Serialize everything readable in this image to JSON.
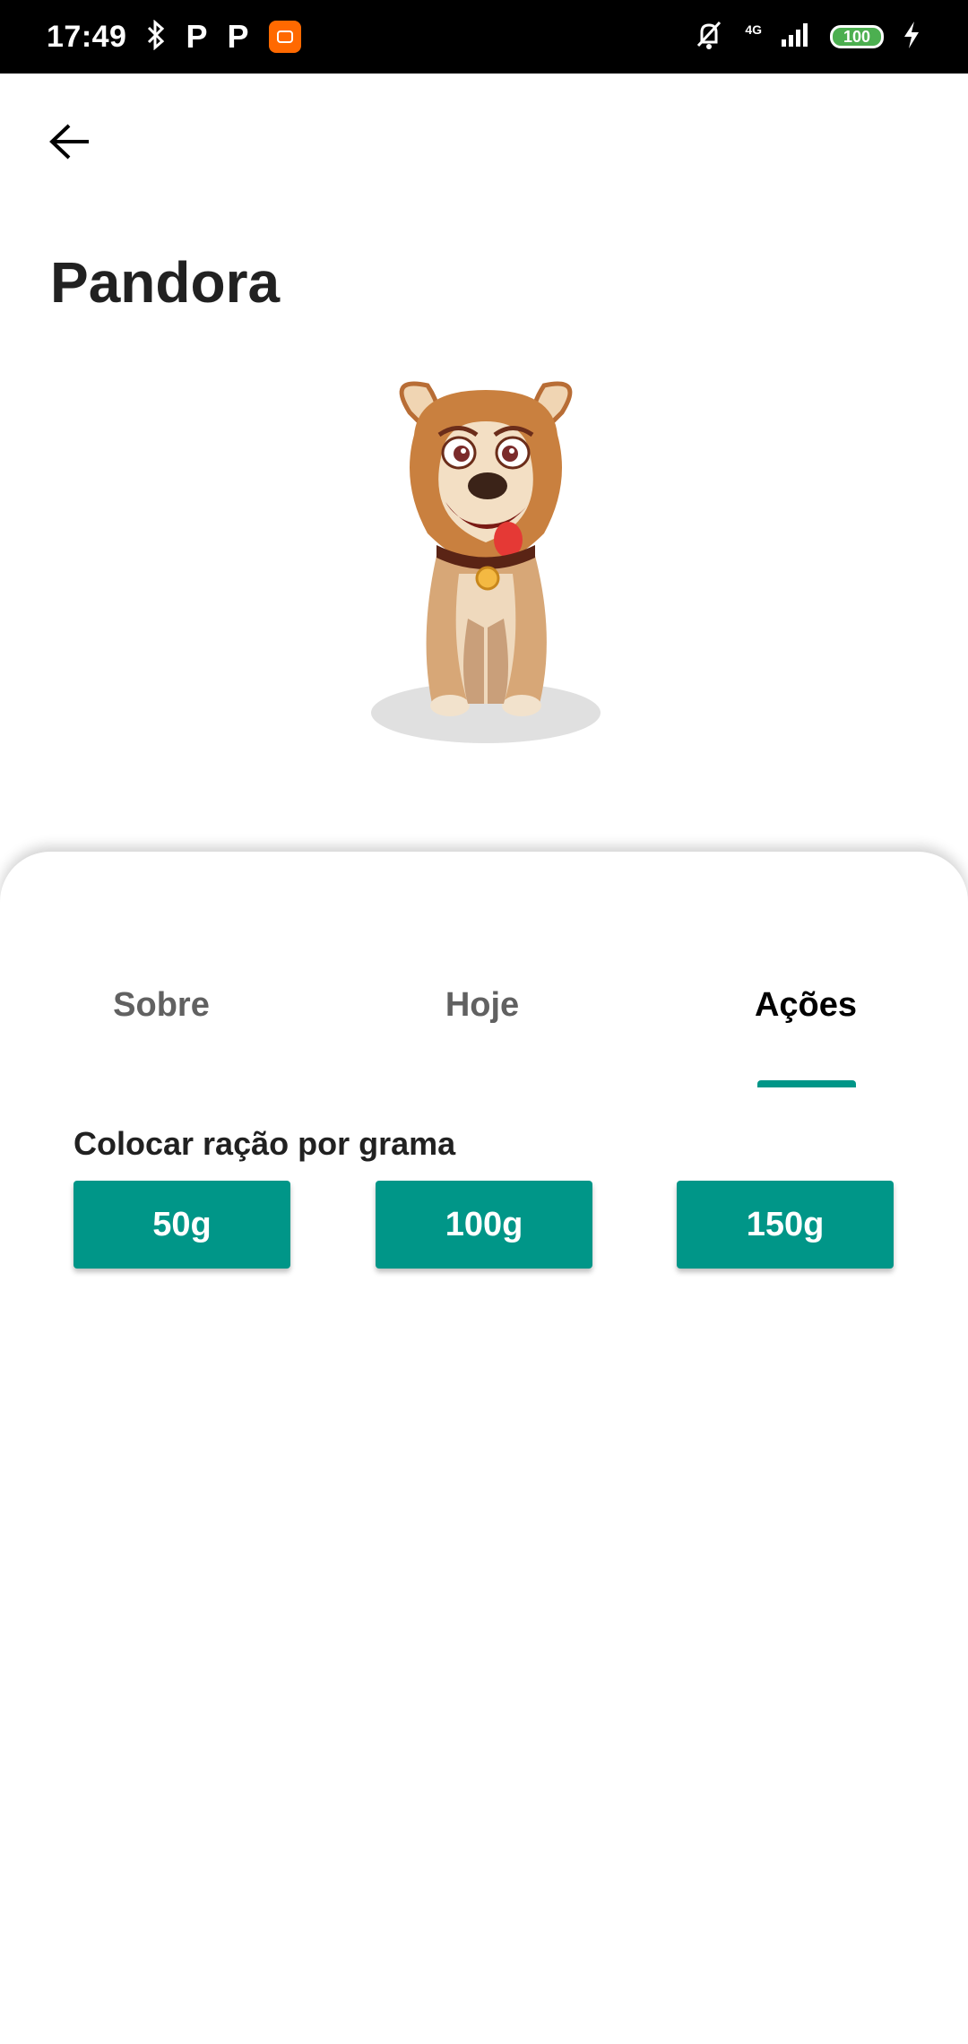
{
  "status_bar": {
    "time": "17:49",
    "network": "4G",
    "battery": "100",
    "icons": [
      "bluetooth-icon",
      "parking-app-icon",
      "parking-app-icon",
      "mi-app-icon",
      "silent-mode-icon",
      "signal-icon",
      "battery-icon",
      "charging-icon"
    ]
  },
  "header": {
    "back_icon": "arrow-left-icon",
    "title": "Pandora"
  },
  "tabs": [
    {
      "label": "Sobre",
      "active": false
    },
    {
      "label": "Hoje",
      "active": false
    },
    {
      "label": "Ações",
      "active": true
    }
  ],
  "actions": {
    "section_label": "Colocar ração por grama",
    "buttons": [
      {
        "label": "50g"
      },
      {
        "label": "100g"
      },
      {
        "label": "150g"
      }
    ]
  },
  "colors": {
    "accent": "#009688",
    "status_bar": "#000000",
    "mi_orange": "#ff6900",
    "battery_green": "#4caf50"
  }
}
